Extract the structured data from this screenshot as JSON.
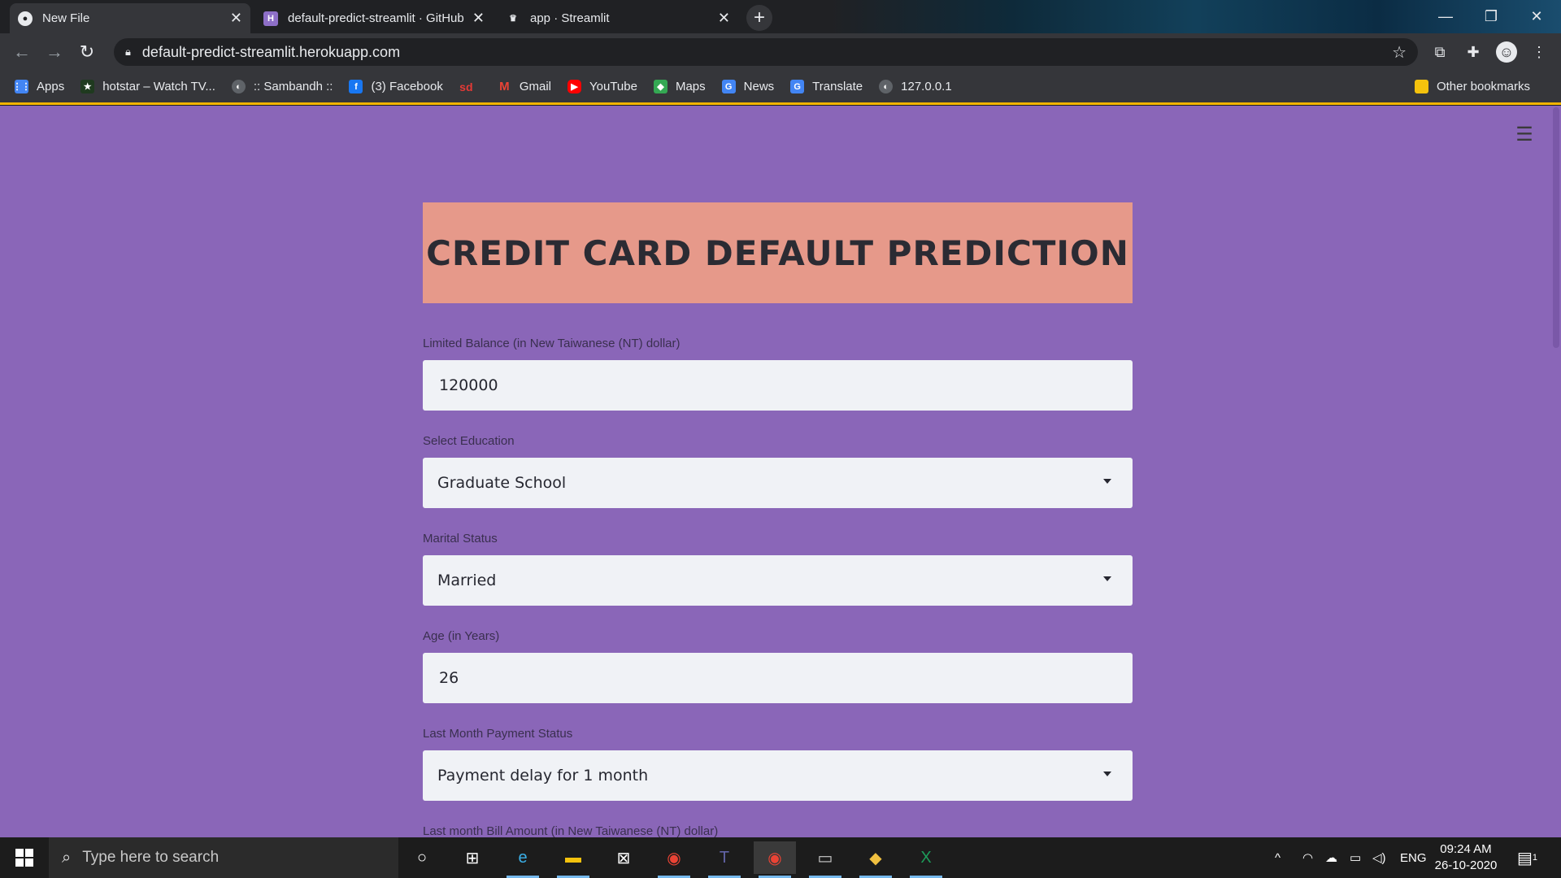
{
  "browser": {
    "tabs": [
      {
        "title": "New File",
        "icon": "github-icon",
        "active": true
      },
      {
        "title": "default-predict-streamlit · GitHub",
        "icon": "heroku-icon",
        "active": false
      },
      {
        "title": "app · Streamlit",
        "icon": "streamlit-icon",
        "active": false
      }
    ],
    "url": "default-predict-streamlit.herokuapp.com",
    "bookmarks": [
      {
        "label": "Apps",
        "icon": "apps-grid-icon",
        "color": "#4285f4"
      },
      {
        "label": "hotstar – Watch TV...",
        "icon": "hotstar-icon",
        "color": "#1f3a1f"
      },
      {
        "label": ":: Sambandh ::",
        "icon": "globe-icon",
        "color": "#5f6368"
      },
      {
        "label": "(3) Facebook",
        "icon": "facebook-icon",
        "color": "#1877f2"
      },
      {
        "label": "",
        "icon": "sd-icon",
        "color": "#e53935"
      },
      {
        "label": "Gmail",
        "icon": "gmail-icon",
        "color": "#ea4335"
      },
      {
        "label": "YouTube",
        "icon": "youtube-icon",
        "color": "#ff0000"
      },
      {
        "label": "Maps",
        "icon": "maps-icon",
        "color": "#34a853"
      },
      {
        "label": "News",
        "icon": "news-icon",
        "color": "#4285f4"
      },
      {
        "label": "Translate",
        "icon": "translate-icon",
        "color": "#4285f4"
      },
      {
        "label": "127.0.0.1",
        "icon": "globe-icon",
        "color": "#5f6368"
      }
    ],
    "other_bookmarks": "Other bookmarks"
  },
  "app": {
    "title": "CREDIT CARD DEFAULT PREDICTION",
    "colors": {
      "background": "#8a66b8",
      "header": "#e6998a",
      "input": "#f0f2f6"
    },
    "fields": [
      {
        "label": "Limited Balance (in New Taiwanese (NT) dollar)",
        "value": "120000",
        "type": "number"
      },
      {
        "label": "Select Education",
        "value": "Graduate School",
        "type": "select"
      },
      {
        "label": "Marital Status",
        "value": "Married",
        "type": "select"
      },
      {
        "label": "Age (in Years)",
        "value": "26",
        "type": "number"
      },
      {
        "label": "Last Month Payment Status",
        "value": "Payment delay for 1 month",
        "type": "select"
      },
      {
        "label": "Last month Bill Amount (in New Taiwanese (NT) dollar)",
        "value": "",
        "type": "number"
      }
    ]
  },
  "taskbar": {
    "search_placeholder": "Type here to search",
    "language": "ENG",
    "time": "09:24 AM",
    "date": "26-10-2020",
    "notifications": "1"
  }
}
